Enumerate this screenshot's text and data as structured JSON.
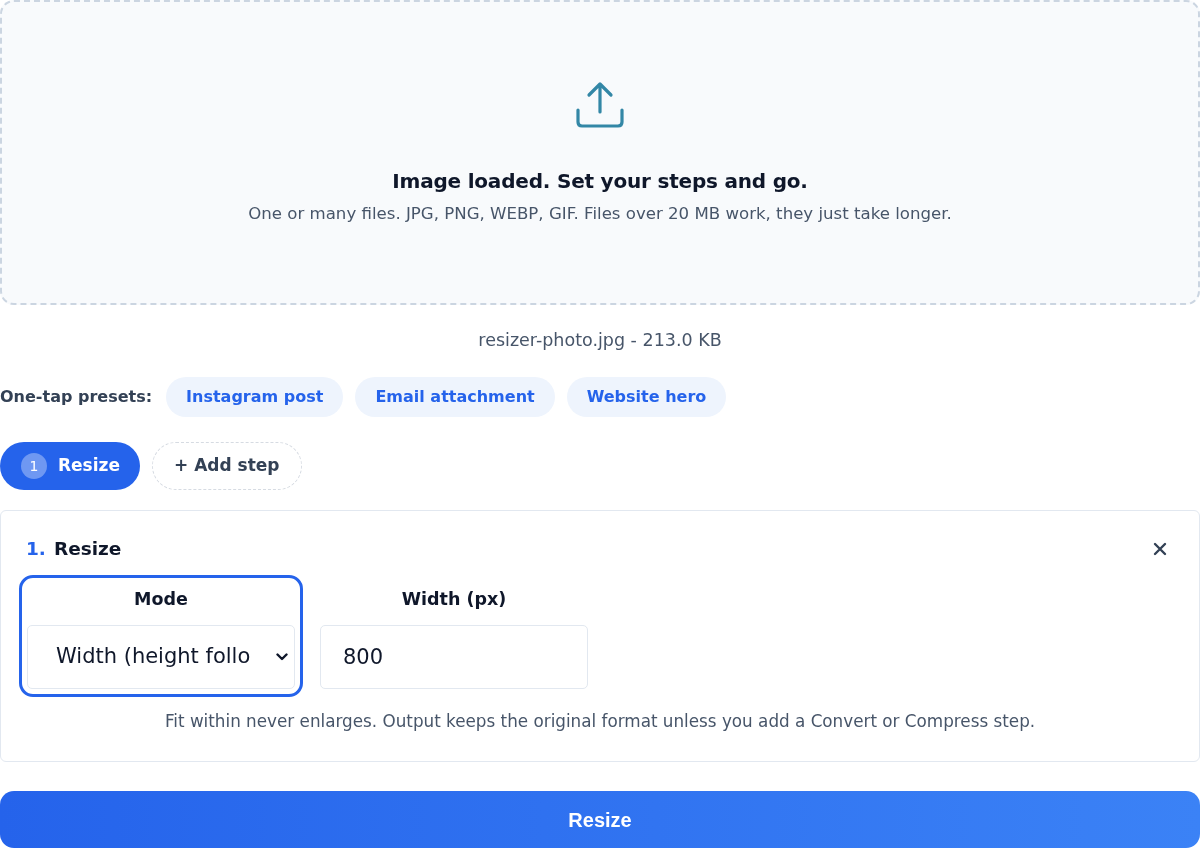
{
  "dropzone": {
    "title": "Image loaded. Set your steps and go.",
    "subtitle": "One or many files. JPG, PNG, WEBP, GIF. Files over 20 MB work, they just take longer."
  },
  "file_info": "resizer-photo.jpg - 213.0 KB",
  "presets": {
    "label": "One-tap presets:",
    "items": [
      "Instagram post",
      "Email attachment",
      "Website hero"
    ]
  },
  "steps": {
    "items": [
      {
        "number": "1",
        "label": "Resize",
        "selected": true
      }
    ],
    "add_button": "+ Add step"
  },
  "step_card": {
    "number": "1.",
    "title": "Resize",
    "fields": [
      {
        "kind": "select",
        "label": "Mode",
        "value": "Width (height follo",
        "focused": true
      },
      {
        "kind": "input",
        "label": "Width (px)",
        "value": "800",
        "focused": false
      }
    ],
    "hint": "Fit within never enlarges. Output keeps the original format unless you add a Convert or Compress step."
  },
  "primary_button": "Resize"
}
